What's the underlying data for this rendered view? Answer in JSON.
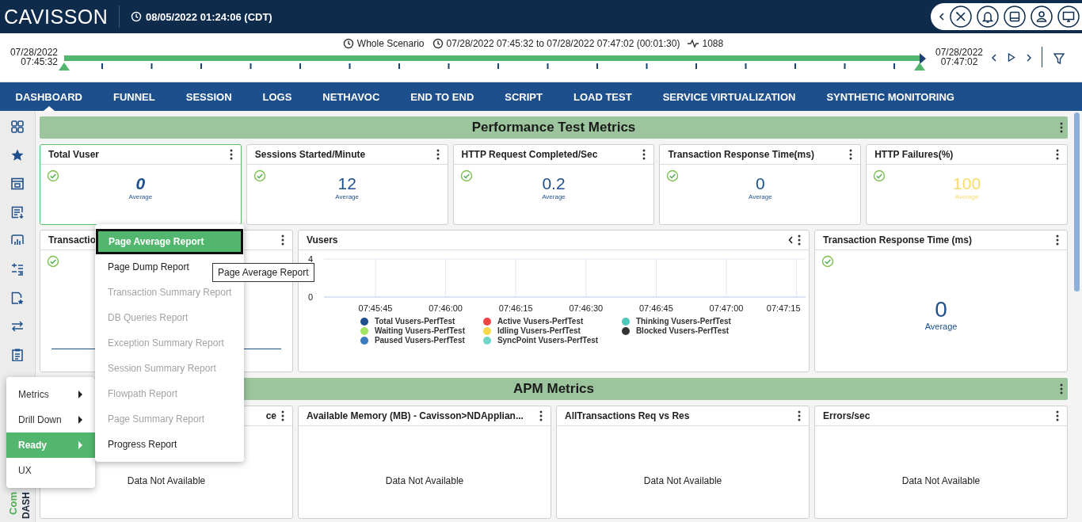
{
  "header": {
    "logo": "CAVISSON",
    "datetime": "08/05/2022 01:24:06 (CDT)"
  },
  "timeline": {
    "scenario": "Whole Scenario",
    "range": "07/28/2022 07:45:32 to 07/28/2022 07:47:02 (00:01:30)",
    "count": "1088",
    "start_date": "07/28/2022",
    "start_time": "07:45:32",
    "end_date": "07/28/2022",
    "end_time": "07:47:02",
    "level": 1
  },
  "tabs": [
    {
      "label": "DASHBOARD",
      "selected": true
    },
    {
      "label": "FUNNEL",
      "selected": false
    },
    {
      "label": "SESSION",
      "selected": false
    },
    {
      "label": "LOGS",
      "selected": false
    },
    {
      "label": "NETHAVOC",
      "selected": false
    },
    {
      "label": "END TO END",
      "selected": false
    },
    {
      "label": "SCRIPT",
      "selected": false
    },
    {
      "label": "LOAD TEST",
      "selected": false
    },
    {
      "label": "SERVICE VIRTUALIZATION",
      "selected": false
    },
    {
      "label": "SYNTHETIC MONITORING",
      "selected": false
    }
  ],
  "sidebar": {
    "labels": [
      {
        "text": "Com",
        "color": "#4caf50"
      },
      {
        "text": "DASH",
        "color": "#1a2a3a"
      }
    ]
  },
  "sections": [
    {
      "title": "Performance Test Metrics",
      "card_groups": [
        {
          "cards": [
            {
              "kind": "stat",
              "title": "Total Vuser",
              "selected": true,
              "check": true,
              "value": "0",
              "value_label": "Average",
              "color": "#1d4f8c"
            },
            {
              "kind": "stat",
              "title": "Sessions Started/Minute",
              "selected": false,
              "check": true,
              "value": "12",
              "value_label": "Average",
              "color": "#1d4f8c"
            },
            {
              "kind": "stat",
              "title": "HTTP Request Completed/Sec",
              "selected": false,
              "check": true,
              "value": "0.2",
              "value_label": "Average",
              "color": "#1d4f8c"
            },
            {
              "kind": "stat",
              "title": "Transaction Response Time(ms)",
              "selected": false,
              "check": true,
              "value": "0",
              "value_label": "Average",
              "color": "#1d4f8c"
            },
            {
              "kind": "stat",
              "title": "HTTP Failures(%)",
              "selected": false,
              "check": true,
              "value": "100",
              "value_label": "Average",
              "color": "#f6dc6e"
            }
          ]
        },
        {
          "cards": [
            {
              "kind": "trend",
              "title": "Transactio",
              "selected": false,
              "check": true
            },
            {
              "kind": "chart",
              "title": "Vusers",
              "selected": false,
              "chart_data": {
                "type": "line",
                "grid": true,
                "categories": [
                  "07:45:45",
                  "07:46:00",
                  "07:46:15",
                  "07:46:30",
                  "07:46:45",
                  "07:47:00",
                  "07:47:15"
                ],
                "ylim": [
                  0,
                  4
                ],
                "yticks": [
                  0,
                  4
                ],
                "series": [
                  {
                    "name": "Total Vusers-PerfTest",
                    "color": "#1f4e8c",
                    "values": [
                      null,
                      null,
                      null,
                      null,
                      null,
                      null,
                      null
                    ]
                  },
                  {
                    "name": "Active Vusers-PerfTest",
                    "color": "#f04545",
                    "values": [
                      null,
                      null,
                      null,
                      null,
                      null,
                      null,
                      null
                    ]
                  },
                  {
                    "name": "Thinking Vusers-PerfTest",
                    "color": "#4cc9b9",
                    "values": [
                      null,
                      null,
                      null,
                      null,
                      null,
                      null,
                      null
                    ]
                  },
                  {
                    "name": "Waiting Vusers-PerfTest",
                    "color": "#a2e35f",
                    "values": [
                      null,
                      null,
                      null,
                      null,
                      null,
                      null,
                      null
                    ]
                  },
                  {
                    "name": "Idling Vusers-PerfTest",
                    "color": "#f6d84a",
                    "values": [
                      null,
                      null,
                      null,
                      null,
                      null,
                      null,
                      null
                    ]
                  },
                  {
                    "name": "Blocked Vusers-PerfTest",
                    "color": "#333333",
                    "values": [
                      null,
                      null,
                      null,
                      null,
                      null,
                      null,
                      null
                    ]
                  },
                  {
                    "name": "Paused Vusers-PerfTest",
                    "color": "#3b7cc1",
                    "values": [
                      null,
                      null,
                      null,
                      null,
                      null,
                      null,
                      null
                    ]
                  },
                  {
                    "name": "SyncPoint Vusers-PerfTest",
                    "color": "#70d8c9",
                    "values": [
                      null,
                      null,
                      null,
                      null,
                      null,
                      null,
                      null
                    ]
                  }
                ]
              }
            },
            {
              "kind": "stat-large",
              "title": "Transaction Response Time (ms)",
              "selected": false,
              "check": true,
              "value": "0",
              "value_label": "Average",
              "color": "#1d4f8c"
            }
          ]
        }
      ]
    },
    {
      "title": "APM Metrics",
      "card_groups": [
        {
          "cards": [
            {
              "kind": "empty",
              "title": "ce",
              "title_cut": true,
              "selected": false,
              "message": "Data Not Available"
            },
            {
              "kind": "empty",
              "title": "Available Memory (MB) - Cavisson>NDApplian...",
              "selected": false,
              "message": "Data Not Available"
            },
            {
              "kind": "empty",
              "title": "AllTransactions Req vs Res",
              "selected": false,
              "message": "Data Not Available"
            },
            {
              "kind": "empty",
              "title": "Errors/sec",
              "selected": false,
              "message": "Data Not Available"
            }
          ]
        }
      ]
    }
  ],
  "context_menu": {
    "items": [
      {
        "label": "Metrics",
        "submenu": true,
        "selected": false
      },
      {
        "label": "Drill Down",
        "submenu": true,
        "selected": false
      },
      {
        "label": "Ready",
        "submenu": true,
        "selected": true
      },
      {
        "label": "UX",
        "submenu": false,
        "selected": false
      }
    ]
  },
  "submenu": {
    "items": [
      {
        "label": "Page Average Report",
        "disabled": false,
        "selected": true
      },
      {
        "label": "Page Dump Report",
        "disabled": false,
        "selected": false
      },
      {
        "label": "Transaction Summary Report",
        "disabled": true,
        "selected": false
      },
      {
        "label": "DB Queries Report",
        "disabled": true,
        "selected": false
      },
      {
        "label": "Exception Summary Report",
        "disabled": true,
        "selected": false
      },
      {
        "label": "Session Summary Report",
        "disabled": true,
        "selected": false
      },
      {
        "label": "Flowpath Report",
        "disabled": true,
        "selected": false
      },
      {
        "label": "Page Summary Report",
        "disabled": true,
        "selected": false
      },
      {
        "label": "Progress Report",
        "disabled": false,
        "selected": false
      }
    ]
  },
  "tooltip": "Page Average Report"
}
